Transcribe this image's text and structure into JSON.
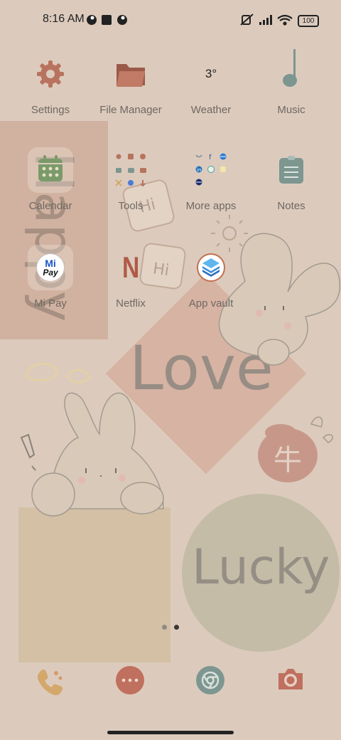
{
  "status_bar": {
    "time": "8:16 AM",
    "battery": "100"
  },
  "apps_row1": [
    {
      "label": "Settings",
      "icon": "gear-icon"
    },
    {
      "label": "File Manager",
      "icon": "folder-icon"
    },
    {
      "label": "Weather",
      "icon": "weather-icon",
      "temp": "3°"
    },
    {
      "label": "Music",
      "icon": "music-note-icon"
    }
  ],
  "apps_row2": [
    {
      "label": "Calendar",
      "icon": "calendar-icon"
    },
    {
      "label": "Tools",
      "icon": "tools-folder-icon"
    },
    {
      "label": "More apps",
      "icon": "apps-folder-icon"
    },
    {
      "label": "Notes",
      "icon": "notes-icon"
    }
  ],
  "apps_row3": [
    {
      "label": "Mi Pay",
      "icon": "mi-pay-icon",
      "logo_top": "Mi",
      "logo_bottom": "Pay"
    },
    {
      "label": "Netflix",
      "icon": "netflix-icon",
      "logo": "N"
    },
    {
      "label": "App vault",
      "icon": "app-vault-icon"
    }
  ],
  "wallpaper": {
    "love": "Love",
    "lucky": "Lucky",
    "happy": "Happy",
    "hi": "Hi",
    "badge": "牛"
  },
  "dock": [
    {
      "name": "phone-icon"
    },
    {
      "name": "messages-icon"
    },
    {
      "name": "browser-icon"
    },
    {
      "name": "camera-icon"
    }
  ],
  "pages": {
    "count": 2,
    "current": 2
  },
  "colors": {
    "background": "#dccbbd",
    "accent_terracotta": "#b8735f",
    "accent_sage": "#7d9690",
    "label": "#6f6862"
  }
}
